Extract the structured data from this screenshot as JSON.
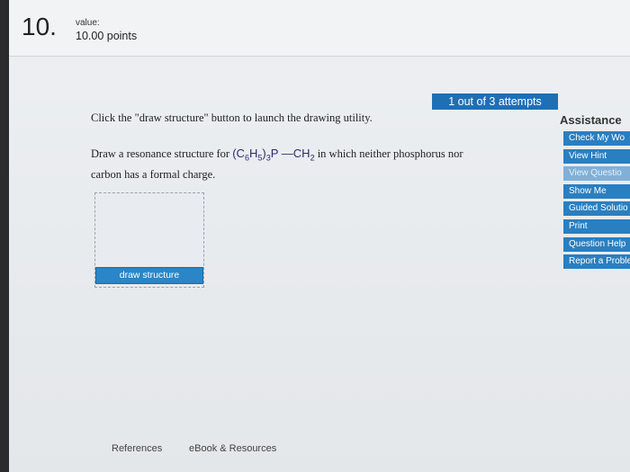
{
  "header": {
    "question_number": "10.",
    "value_label": "value:",
    "points": "10.00 points"
  },
  "attempts_badge": "1 out of 3 attempts",
  "instruction": "Click the \"draw structure\" button to launch the drawing utility.",
  "question": {
    "prefix": "Draw a resonance structure for",
    "formula_group": "(C",
    "sub1": "6",
    "h": "H",
    "sub2": "5",
    "close": ")",
    "sub3": "3",
    "p": "P",
    "bond": "—",
    "c": "C",
    "h2": "H",
    "sub4": "2",
    "suffix_line1": "in which neither phosphorus nor",
    "line2": "carbon has a formal charge."
  },
  "draw_button": "draw structure",
  "assistance": {
    "title": "Assistance",
    "items": [
      {
        "label": "Check My Wo",
        "disabled": false
      },
      {
        "label": "View Hint",
        "disabled": false
      },
      {
        "label": "View Questio",
        "disabled": true
      },
      {
        "label": "Show Me",
        "disabled": false
      },
      {
        "label": "Guided Solutio",
        "disabled": false
      },
      {
        "label": "Print",
        "disabled": false
      },
      {
        "label": "Question Help",
        "disabled": false
      },
      {
        "label": "Report a Proble",
        "disabled": false
      }
    ]
  },
  "footer": {
    "references": "References",
    "ebook": "eBook & Resources"
  }
}
